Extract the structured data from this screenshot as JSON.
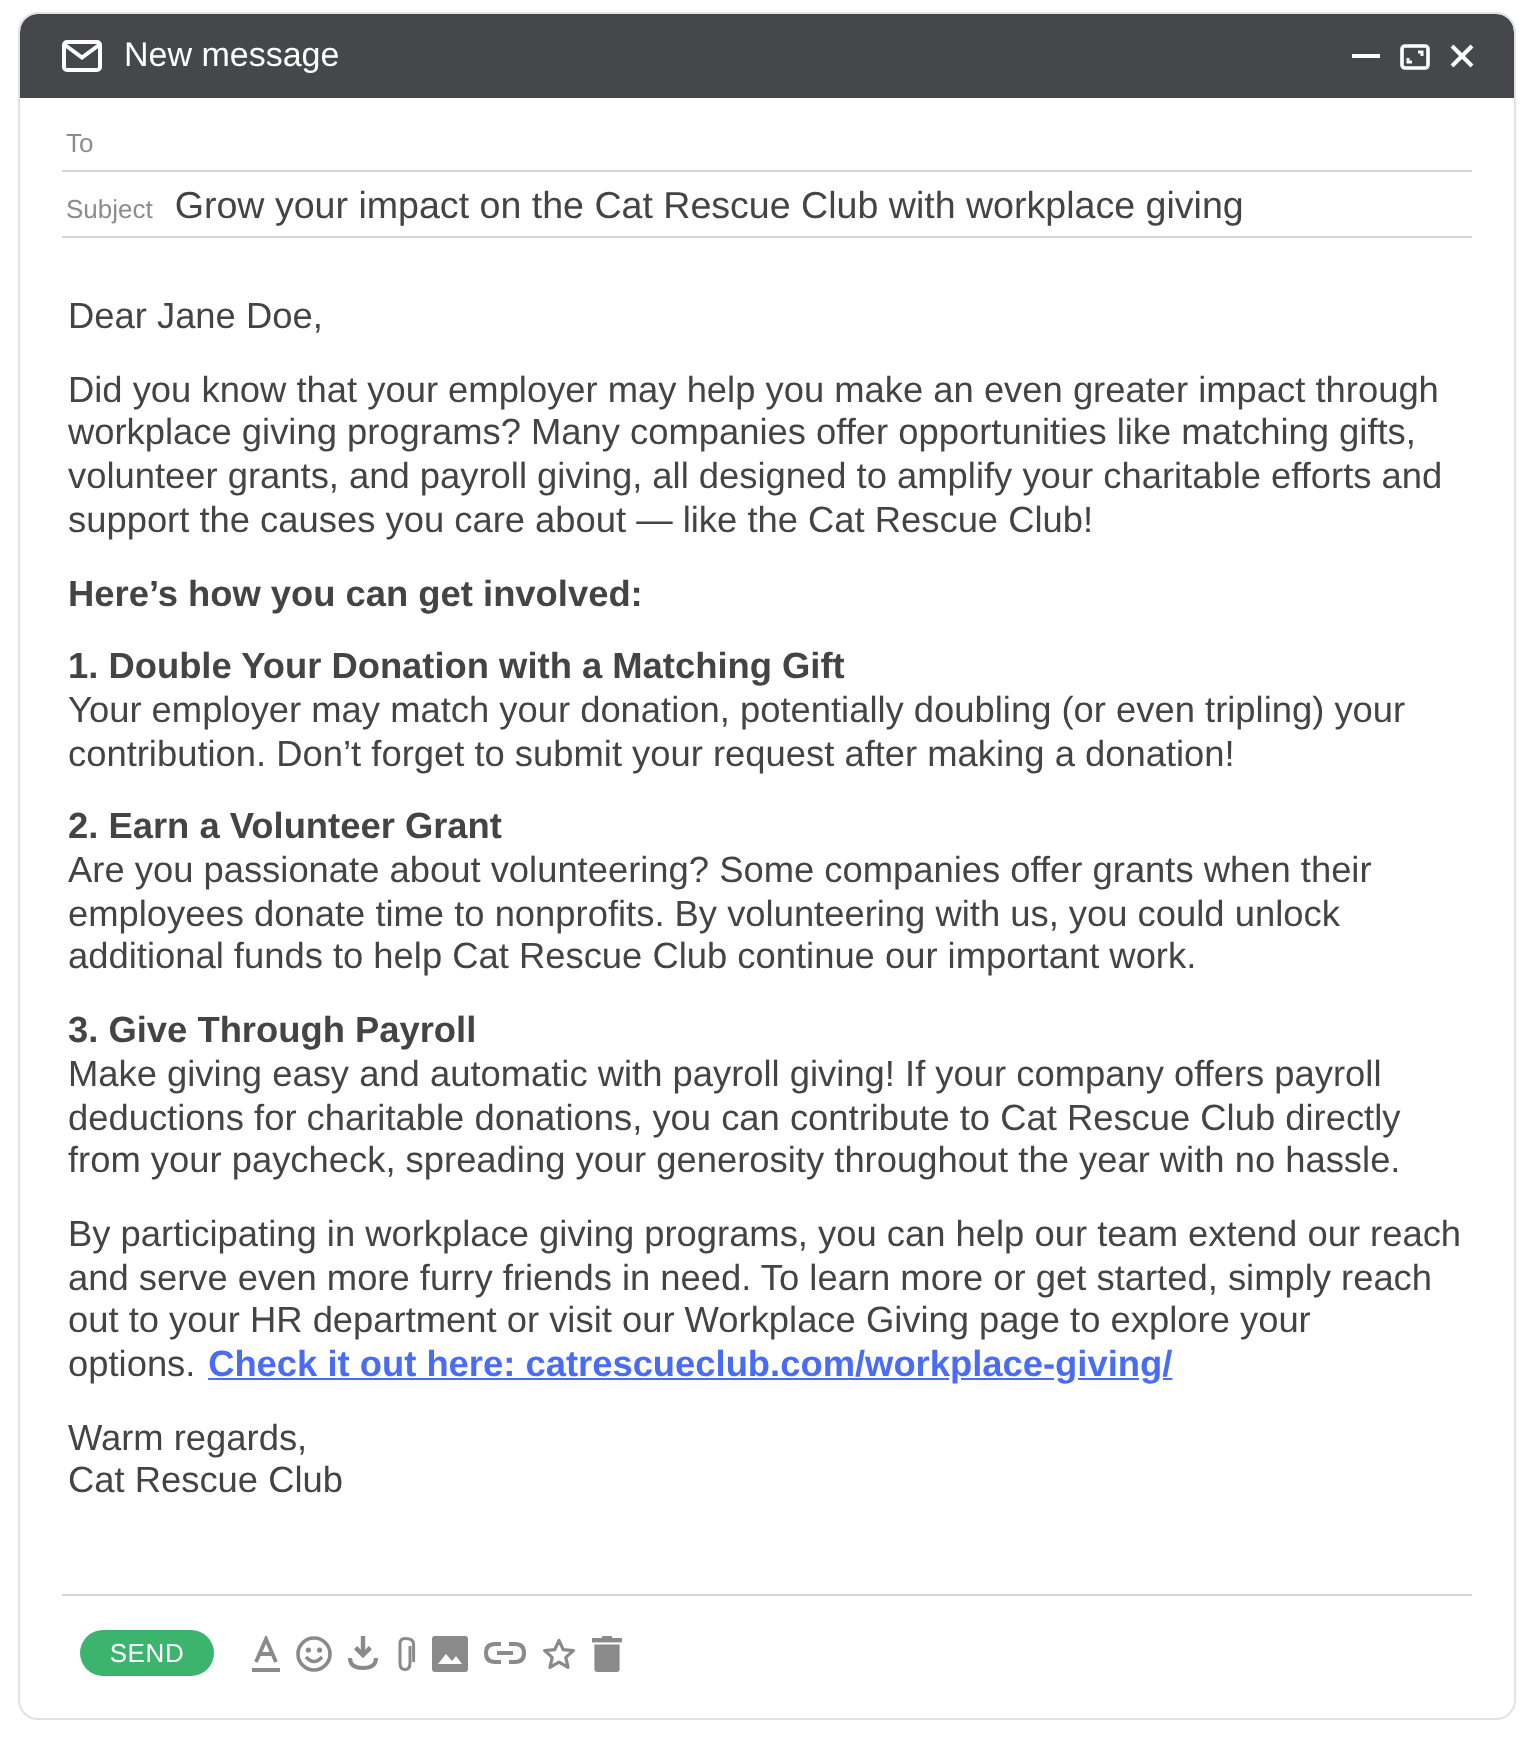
{
  "window": {
    "title": "New message"
  },
  "fields": {
    "to": {
      "label": "To"
    },
    "subject": {
      "label": "Subject",
      "value": "Grow your impact on the Cat Rescue Club with workplace giving"
    }
  },
  "body": {
    "greeting": "Dear Jane Doe,",
    "intro": "Did you know that your employer may help you make an even greater impact through workplace giving programs? Many companies offer opportunities like matching gifts, volunteer grants, and payroll giving, all designed to amplify your charitable efforts and support the causes you care about — like the Cat Rescue Club!",
    "lead": "Here’s how you can get involved:",
    "steps": [
      {
        "title": "1. Double Your Donation with a Matching Gift",
        "text": "Your employer may match your donation, potentially doubling (or even tripling) your contribution. Don’t forget to submit your request after making a donation!"
      },
      {
        "title": "2. Earn a Volunteer Grant",
        "text": "Are you passionate about volunteering? Some companies offer grants when their employees donate time to nonprofits. By volunteering with us, you could unlock additional funds to help Cat Rescue Club continue our important work."
      },
      {
        "title": "3. Give Through Payroll",
        "text": "Make giving easy and automatic with payroll giving! If your company offers payroll deductions for charitable donations, you can contribute to Cat Rescue Club directly from your paycheck, spreading your generosity throughout the year with no hassle."
      }
    ],
    "closing": {
      "text": "By participating in workplace giving programs, you can help our team extend our reach and serve even more furry friends in need. To learn more or get started, simply reach out to your HR department or visit our Workplace Giving page to explore your options.",
      "link": "Check it out here: catrescueclub.com/workplace-giving/"
    },
    "signature": {
      "salutation": "Warm regards,",
      "name": "Cat Rescue Club"
    }
  },
  "toolbar": {
    "send_label": "SEND"
  }
}
